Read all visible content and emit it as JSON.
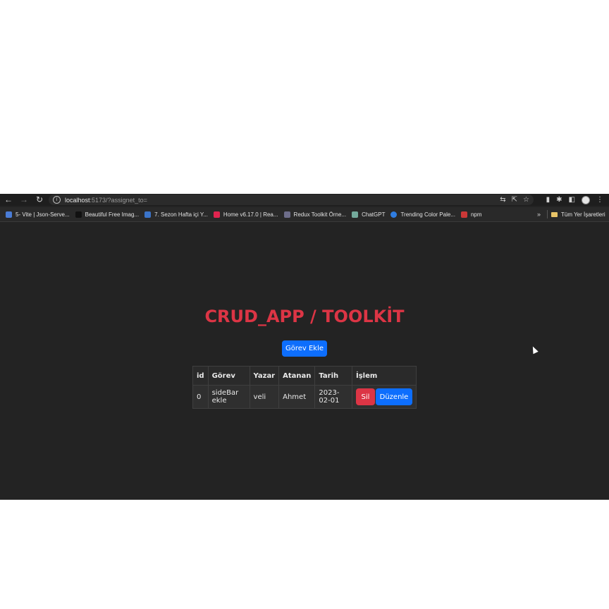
{
  "browser": {
    "url_host": "localhost",
    "url_path": ":5173/?assignet_to=",
    "nav": {
      "back": "←",
      "forward": "→",
      "reload": "↻"
    },
    "bookmarks": [
      {
        "label": "5- Vite | Json-Serve...",
        "color": "#4a7cd6"
      },
      {
        "label": "Beautiful Free Imag...",
        "color": "#111111"
      },
      {
        "label": "7. Sezon Hafta içi Y...",
        "color": "#3b74c9"
      },
      {
        "label": "Home v6.17.0 | Rea...",
        "color": "#e0244f"
      },
      {
        "label": "Redux Toolkit Örne...",
        "color": "#6d6d8a"
      },
      {
        "label": "ChatGPT",
        "color": "#74aa9c"
      },
      {
        "label": "Trending Color Pale...",
        "color": "#2f7de1"
      },
      {
        "label": "npm",
        "color": "#cb3837"
      }
    ],
    "bookmarks_more": "»",
    "all_bookmarks": "Tüm Yer İşaretleri"
  },
  "app": {
    "title": "CRUD_APP / TOOLKİT",
    "add_button": "Görev Ekle",
    "table": {
      "headers": [
        "id",
        "Görev",
        "Yazar",
        "Atanan",
        "Tarih",
        "İşlem"
      ],
      "rows": [
        {
          "id": "0",
          "gorev": "sideBar ekle",
          "yazar": "veli",
          "atanan": "Ahmet",
          "tarih": "2023-02-01"
        }
      ]
    },
    "delete_button": "Sil",
    "edit_button": "Düzenle"
  },
  "colors": {
    "title": "#dc3545",
    "primary": "#0d6efd",
    "danger": "#dc3545",
    "page_bg": "#232323"
  }
}
